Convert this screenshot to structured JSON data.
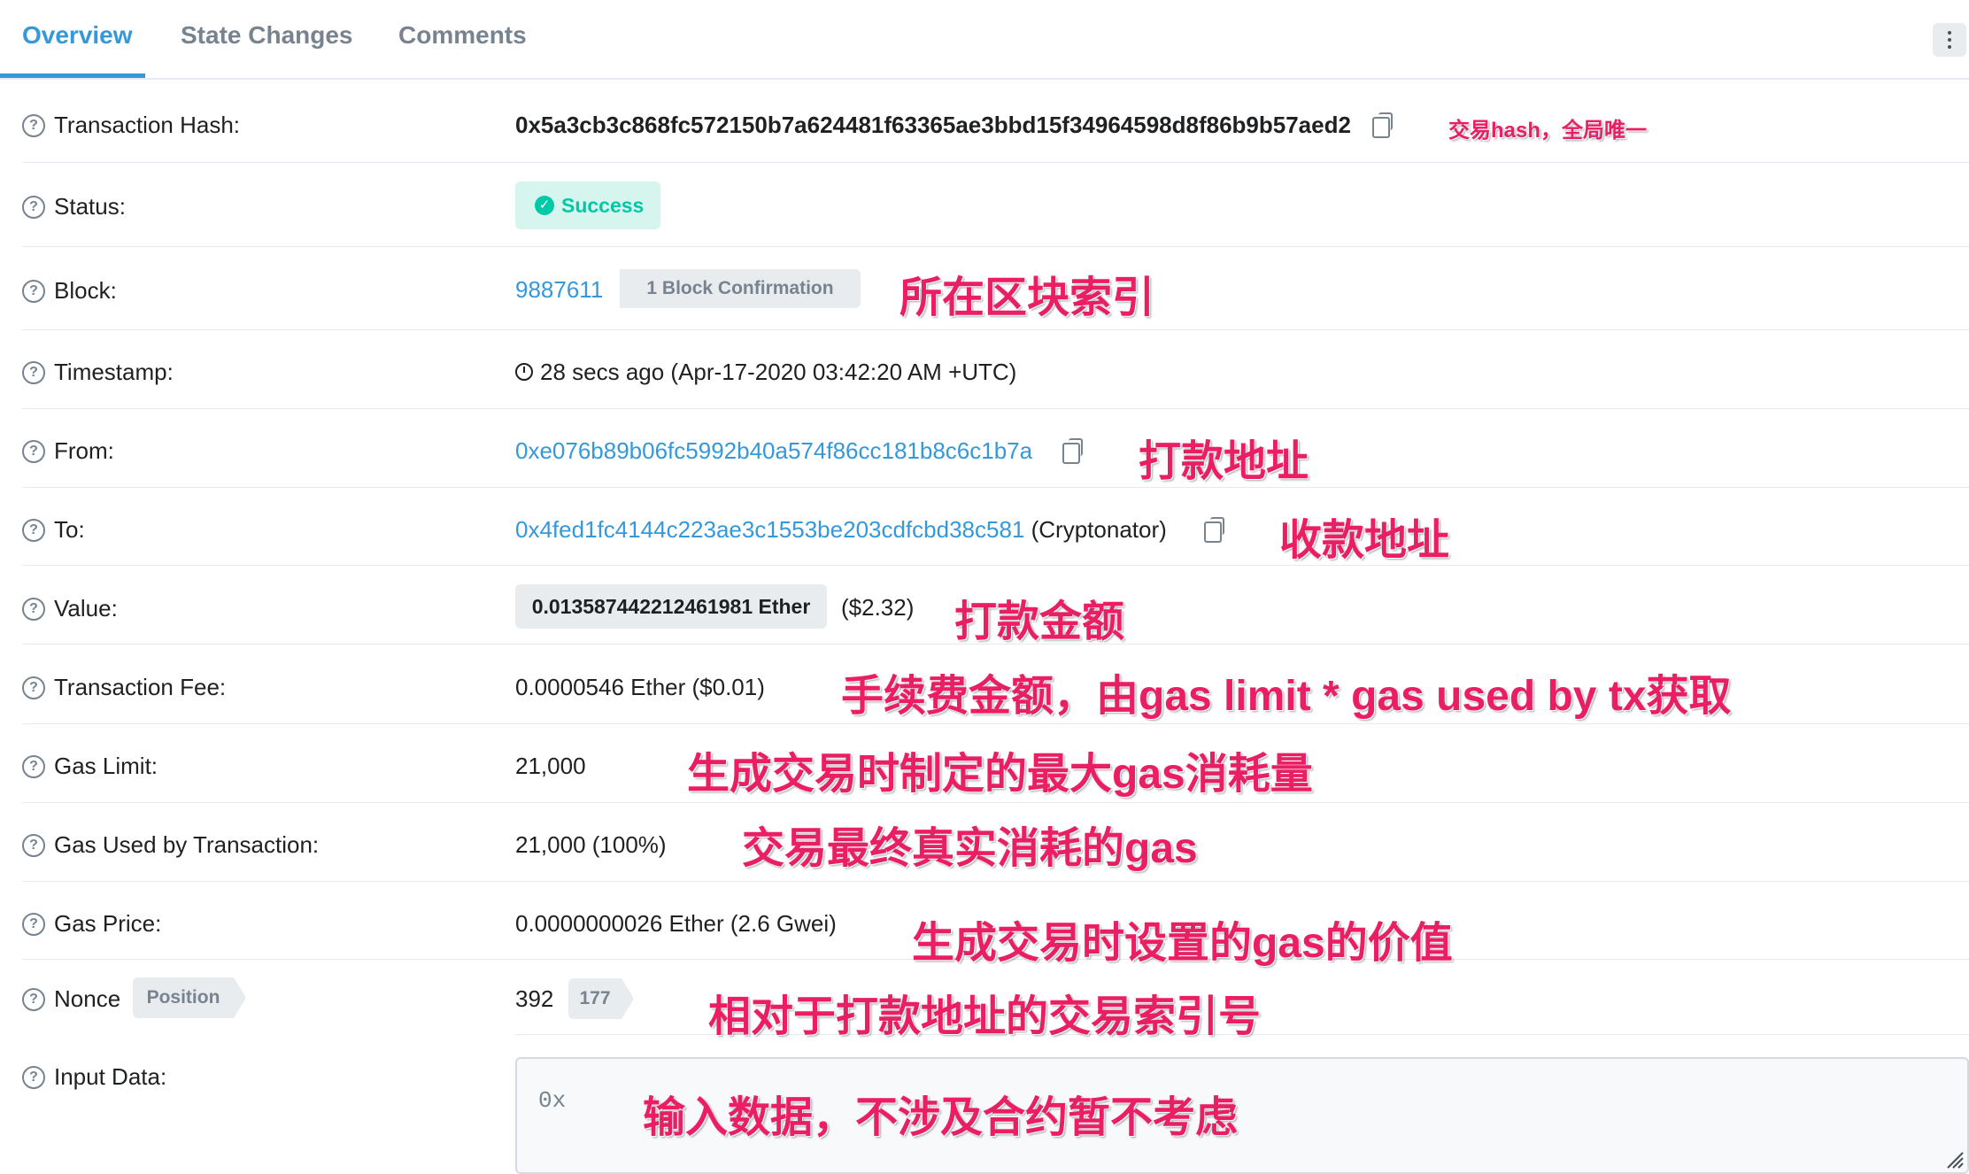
{
  "tabs": [
    {
      "label": "Overview",
      "active": true
    },
    {
      "label": "State Changes",
      "active": false
    },
    {
      "label": "Comments",
      "active": false
    }
  ],
  "rows": {
    "tx_hash": {
      "label": "Transaction Hash:",
      "value": "0x5a3cb3c868fc572150b7a624481f63365ae3bbd15f34964598d8f86b9b57aed2",
      "note": "交易hash，全局唯一"
    },
    "status": {
      "label": "Status:",
      "value": "Success"
    },
    "block": {
      "label": "Block:",
      "value": "9887611",
      "confirmation": "1 Block Confirmation",
      "note": "所在区块索引"
    },
    "timestamp": {
      "label": "Timestamp:",
      "value": "28 secs ago (Apr-17-2020 03:42:20 AM +UTC)"
    },
    "from": {
      "label": "From:",
      "value": "0xe076b89b06fc5992b40a574f86cc181b8c6c1b7a",
      "note": "打款地址"
    },
    "to": {
      "label": "To:",
      "value": "0x4fed1fc4144c223ae3c1553be203cdfcbd38c581",
      "name_tag": "(Cryptonator)",
      "note": "收款地址"
    },
    "value": {
      "label": "Value:",
      "amount": "0.013587442212461981 Ether",
      "usd": "($2.32)",
      "note": "打款金额"
    },
    "tx_fee": {
      "label": "Transaction Fee:",
      "value": "0.0000546 Ether ($0.01)",
      "note": "手续费金额，由gas limit * gas used by tx获取"
    },
    "gas_limit": {
      "label": "Gas Limit:",
      "value": "21,000",
      "note": "生成交易时制定的最大gas消耗量"
    },
    "gas_used": {
      "label": "Gas Used by Transaction:",
      "value": "21,000 (100%)",
      "note": "交易最终真实消耗的gas"
    },
    "gas_price": {
      "label": "Gas Price:",
      "value": "0.0000000026 Ether (2.6 Gwei)",
      "note": "生成交易时设置的gas的价值"
    },
    "nonce": {
      "label": "Nonce",
      "position_tag": "Position",
      "value": "392",
      "position_value": "177",
      "note": "相对于打款地址的交易索引号"
    },
    "input_data": {
      "label": "Input Data:",
      "value": "0x",
      "note": "输入数据，不涉及合约暂不考虑"
    }
  },
  "colors": {
    "link": "#3498db",
    "success": "#00c9a7",
    "annotation": "#e91e63"
  }
}
